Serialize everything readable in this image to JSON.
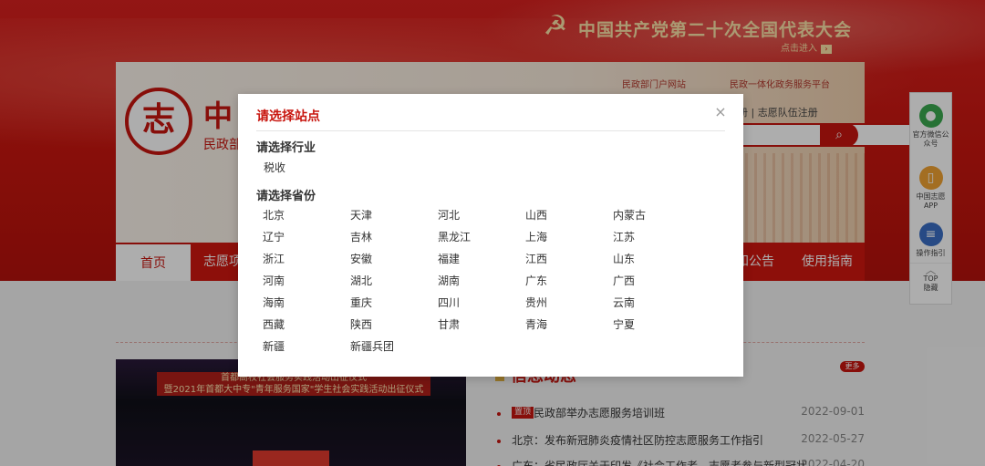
{
  "banner": {
    "congress_title": "中国共产党第二十次全国代表大会",
    "enter_label": "点击进入"
  },
  "header": {
    "link_portal": "民政部门户网站",
    "link_service": "民政一体化政务服务平台",
    "site_name": "中",
    "site_sub": "民政部",
    "logo_char": "志",
    "login_links": "册 | 志愿队伍注册"
  },
  "nav": {
    "home": "首页",
    "volunteer": "志愿项",
    "notice": "知公告",
    "guide": "使用指南"
  },
  "news": {
    "heading": "信息动态",
    "more": "更多",
    "items": [
      {
        "tag": "置顶",
        "text": "民政部举办志愿服务培训班",
        "date": "2022-09-01"
      },
      {
        "tag": "",
        "text": "北京：发布新冠肺炎疫情社区防控志愿服务工作指引",
        "date": "2022-05-27"
      },
      {
        "tag": "",
        "text": "广东：省民政厅关于印发《社会工作者、志愿者参与新型冠状",
        "date": "2022-04-20"
      }
    ],
    "photo_caption": "首都高校社会服务实践活动出征仪式\n暨2021年首都大中专\"青年服务国家\"学生社会实践活动出征仪式"
  },
  "side_tools": {
    "wechat": "官方微信公众号",
    "app": "中国志愿APP",
    "guide": "操作指引",
    "top": "TOP",
    "hide": "隐藏"
  },
  "modal": {
    "title": "请选择站点",
    "industry_label": "请选择行业",
    "industries": [
      "税收"
    ],
    "province_label": "请选择省份",
    "provinces": [
      "北京",
      "天津",
      "河北",
      "山西",
      "内蒙古",
      "辽宁",
      "吉林",
      "黑龙江",
      "上海",
      "江苏",
      "浙江",
      "安徽",
      "福建",
      "江西",
      "山东",
      "河南",
      "湖北",
      "湖南",
      "广东",
      "广西",
      "海南",
      "重庆",
      "四川",
      "贵州",
      "云南",
      "西藏",
      "陕西",
      "甘肃",
      "青海",
      "宁夏",
      "新疆",
      "新疆兵团"
    ]
  },
  "icons": {
    "close": "close-icon",
    "search": "search-icon",
    "wechat": "wechat-icon",
    "app": "phone-icon",
    "guide": "guide-icon",
    "top": "chevron-up-icon",
    "emblem": "party-emblem-icon"
  },
  "colors": {
    "brand_red": "#c8160f",
    "gold": "#fbe3a8"
  }
}
